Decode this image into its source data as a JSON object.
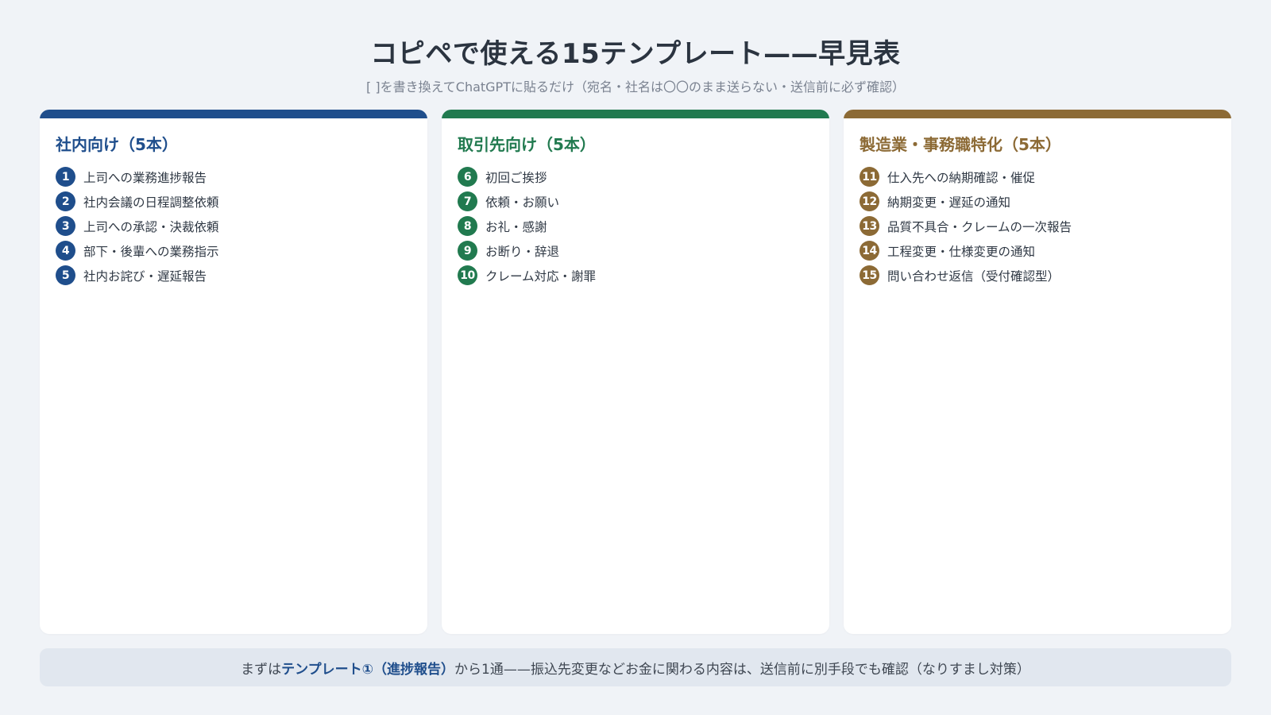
{
  "header": {
    "title": "コピペで使える15テンプレート——早見表",
    "subtitle": "[ ]を書き換えてChatGPTに貼るだけ（宛名・社名は〇〇のまま送らない・送信前に必ず確認）"
  },
  "colors": {
    "internal": "#1f4e8c",
    "client": "#217a4f",
    "manufacturing": "#8c6a35"
  },
  "columns": [
    {
      "title": "社内向け（5本）",
      "items": [
        {
          "num": "1",
          "label": "上司への業務進捗報告"
        },
        {
          "num": "2",
          "label": "社内会議の日程調整依頼"
        },
        {
          "num": "3",
          "label": "上司への承認・決裁依頼"
        },
        {
          "num": "4",
          "label": "部下・後輩への業務指示"
        },
        {
          "num": "5",
          "label": "社内お詫び・遅延報告"
        }
      ]
    },
    {
      "title": "取引先向け（5本）",
      "items": [
        {
          "num": "6",
          "label": "初回ご挨拶"
        },
        {
          "num": "7",
          "label": "依頼・お願い"
        },
        {
          "num": "8",
          "label": "お礼・感謝"
        },
        {
          "num": "9",
          "label": "お断り・辞退"
        },
        {
          "num": "10",
          "label": "クレーム対応・謝罪"
        }
      ]
    },
    {
      "title": "製造業・事務職特化（5本）",
      "items": [
        {
          "num": "11",
          "label": "仕入先への納期確認・催促"
        },
        {
          "num": "12",
          "label": "納期変更・遅延の通知"
        },
        {
          "num": "13",
          "label": "品質不具合・クレームの一次報告"
        },
        {
          "num": "14",
          "label": "工程変更・仕様変更の通知"
        },
        {
          "num": "15",
          "label": "問い合わせ返信（受付確認型）"
        }
      ]
    }
  ],
  "footer": {
    "prefix": "まずは",
    "highlight": "テンプレート①（進捗報告）",
    "suffix": "から1通——振込先変更などお金に関わる内容は、送信前に別手段でも確認（なりすまし対策）"
  }
}
